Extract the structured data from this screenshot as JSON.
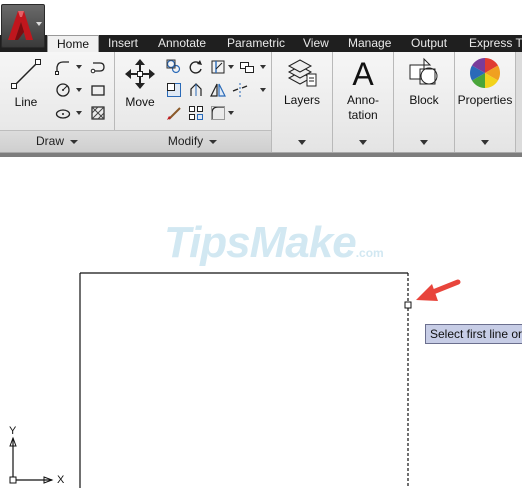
{
  "tabs": [
    {
      "label": "Home",
      "active": true
    },
    {
      "label": "Insert"
    },
    {
      "label": "Annotate"
    },
    {
      "label": "Parametric"
    },
    {
      "label": "View"
    },
    {
      "label": "Manage"
    },
    {
      "label": "Output"
    },
    {
      "label": "Express To"
    }
  ],
  "ribbon": {
    "draw": {
      "title": "Draw",
      "line_label": "Line"
    },
    "modify": {
      "title": "Modify",
      "move_label": "Move"
    },
    "layers": {
      "label": "Layers"
    },
    "annotation": {
      "label_line1": "Anno-",
      "label_line2": "tation"
    },
    "block": {
      "label": "Block"
    },
    "properties": {
      "label": "Properties"
    }
  },
  "canvas": {
    "watermark": "TipsMake",
    "watermark_suffix": ".com",
    "tooltip": "Select first line or",
    "ucs_x": "X",
    "ucs_y": "Y"
  },
  "colors": {
    "ribbon_tab_bar": "#1f1f1f",
    "tooltip_bg": "#c7cde6",
    "arrow": "#e8453c",
    "autocad_red": "#c0161d"
  }
}
